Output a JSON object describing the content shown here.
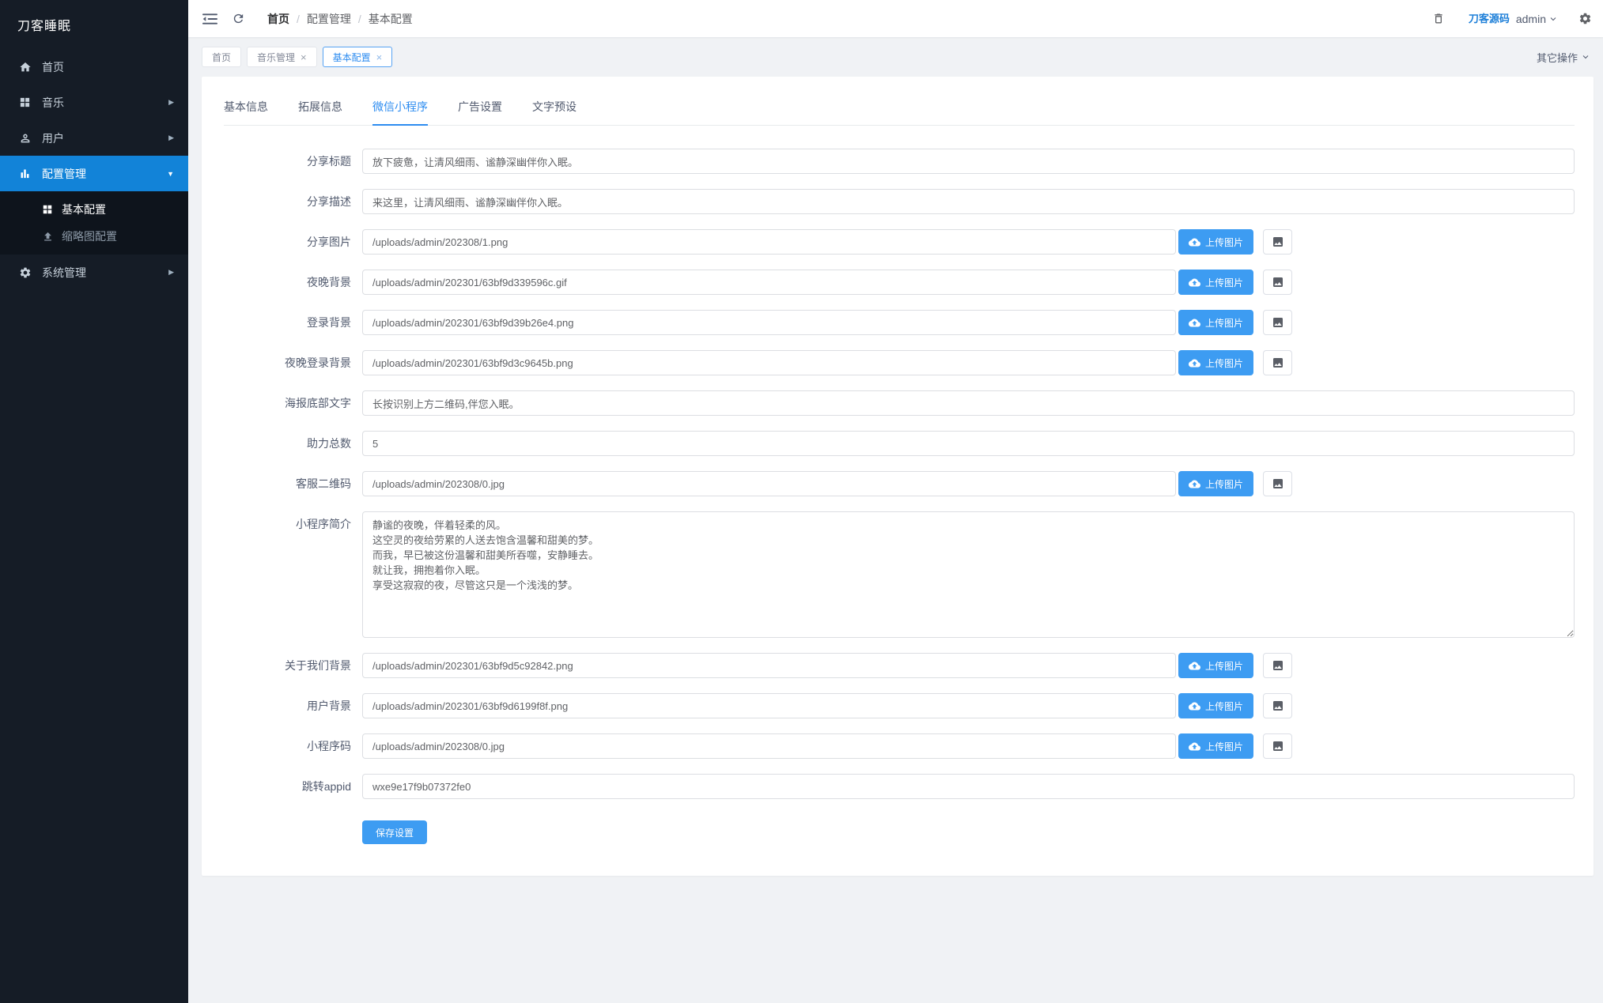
{
  "brand": "刀客睡眠",
  "sidebar": {
    "home": "首页",
    "music": "音乐",
    "user": "用户",
    "config": "配置管理",
    "system": "系统管理",
    "sub_basic": "基本配置",
    "sub_thumb": "缩略图配置",
    "arrow_right": "▶",
    "arrow_down": "▼"
  },
  "topbar": {
    "breadcrumb": {
      "home": "首页",
      "level1": "配置管理",
      "level2": "基本配置",
      "separator": "/"
    },
    "logo_text": "刀客源码",
    "username": "admin"
  },
  "tabstrip": {
    "tab_home": "首页",
    "tab_music": "音乐管理",
    "tab_basic": "基本配置",
    "close": "×",
    "more_label": "其它操作"
  },
  "form_tabs": {
    "t0": "基本信息",
    "t1": "拓展信息",
    "t2": "微信小程序",
    "t3": "广告设置",
    "t4": "文字预设"
  },
  "labels": {
    "upload": "上传图片",
    "save": "保存设置"
  },
  "form": {
    "fields": [
      {
        "label": "分享标题",
        "value": "放下疲惫，让清风细雨、谧静深幽伴你入眠。"
      },
      {
        "label": "分享描述",
        "value": "来这里，让清风细雨、谧静深幽伴你入眠。"
      },
      {
        "label": "分享图片",
        "value": "/uploads/admin/202308/1.png"
      },
      {
        "label": "夜晚背景",
        "value": "/uploads/admin/202301/63bf9d339596c.gif"
      },
      {
        "label": "登录背景",
        "value": "/uploads/admin/202301/63bf9d39b26e4.png"
      },
      {
        "label": "夜晚登录背景",
        "value": "/uploads/admin/202301/63bf9d3c9645b.png"
      },
      {
        "label": "海报底部文字",
        "value": "长按识别上方二维码,伴您入眠。"
      },
      {
        "label": "助力总数",
        "value": "5"
      },
      {
        "label": "客服二维码",
        "value": "/uploads/admin/202308/0.jpg"
      },
      {
        "label": "小程序简介",
        "value": "静谧的夜晚，伴着轻柔的风。\n这空灵的夜给劳累的人送去饱含温馨和甜美的梦。\n而我，早已被这份温馨和甜美所吞噬，安静睡去。\n就让我，拥抱着你入眠。\n享受这寂寂的夜，尽管这只是一个浅浅的梦。"
      },
      {
        "label": "关于我们背景",
        "value": "/uploads/admin/202301/63bf9d5c92842.png"
      },
      {
        "label": "用户背景",
        "value": "/uploads/admin/202301/63bf9d6199f8f.png"
      },
      {
        "label": "小程序码",
        "value": "/uploads/admin/202308/0.jpg"
      },
      {
        "label": "跳转appid",
        "value": "wxe9e17f9b07372fe0"
      }
    ]
  }
}
